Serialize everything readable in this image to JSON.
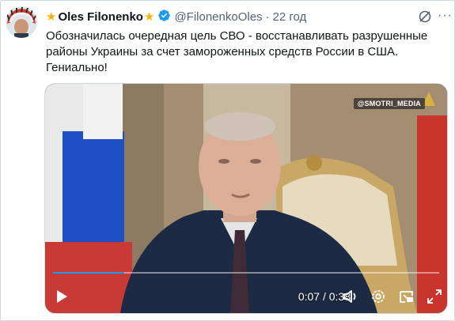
{
  "tweet": {
    "author_name": "Oles Filonenko",
    "handle": "@FilonenkoOles",
    "separator": "·",
    "time": "22 год",
    "text": "Обозначилась очередная цель СВО - восстанавливать разрушенные районы Украины за счет замороженных средств России в США. Гениально!"
  },
  "video": {
    "watermark": "@SMOTRI_MEDIA",
    "current_time": "0:07",
    "duration": "0:38",
    "time_display": "0:07 / 0:38",
    "progress": 0.184
  },
  "icons": [
    "star-icon",
    "verified-badge-icon",
    "grok-icon",
    "more-icon",
    "play-icon",
    "volume-icon",
    "settings-icon",
    "picture-in-picture-icon",
    "fullscreen-icon"
  ],
  "colors": {
    "accent": "#1d9bf0",
    "star": "#f4b400",
    "secondary_text": "#536471"
  }
}
